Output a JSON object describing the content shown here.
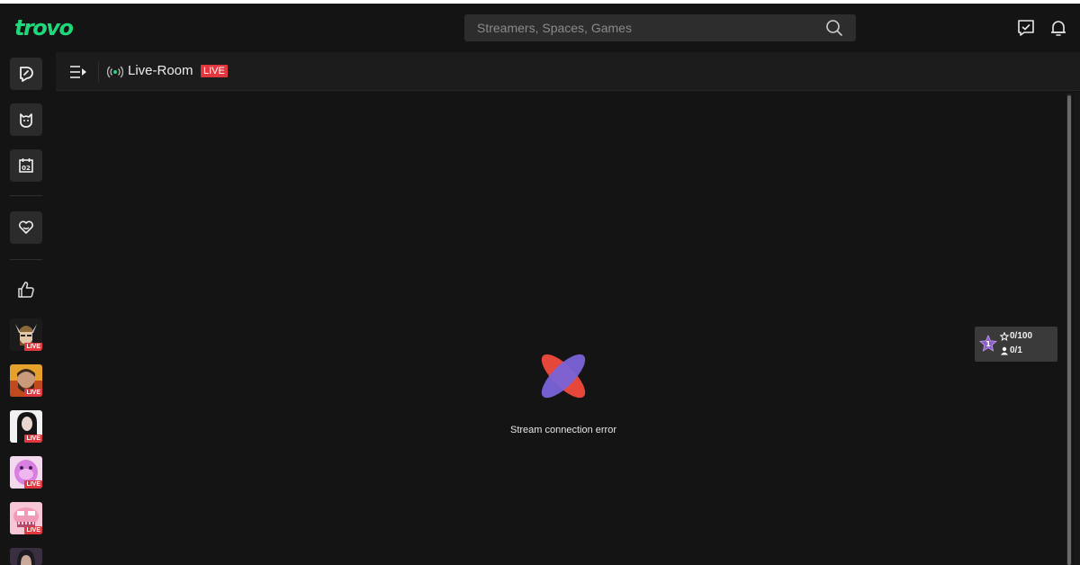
{
  "header": {
    "logo_text": "trovo",
    "search_placeholder": "Streamers, Spaces, Games",
    "icons": [
      "search-icon",
      "message-icon",
      "bell-icon"
    ]
  },
  "sidebar": {
    "nav": [
      "trovo-home-icon",
      "category-icon",
      "calendar-icon",
      "heart-icon",
      "thumbs-up-icon"
    ],
    "calendar_day": "02",
    "live_label": "LIVE",
    "channels": [
      {
        "name": "viking-avatar",
        "live": true
      },
      {
        "name": "bearded-man-avatar",
        "live": true
      },
      {
        "name": "girl-avatar",
        "live": true
      },
      {
        "name": "pink-character-avatar",
        "live": true
      },
      {
        "name": "pink-monster-avatar",
        "live": true
      },
      {
        "name": "partial-avatar",
        "live": false
      }
    ]
  },
  "room_bar": {
    "title": "Live-Room",
    "live_badge": "LIVE"
  },
  "player": {
    "error_text": "Stream connection error"
  },
  "goal_widget": {
    "level": "1",
    "stars": "0/100",
    "users": "0/1"
  },
  "colors": {
    "brand": "#1fd87a",
    "live": "#e2373f",
    "background": "#141414"
  }
}
